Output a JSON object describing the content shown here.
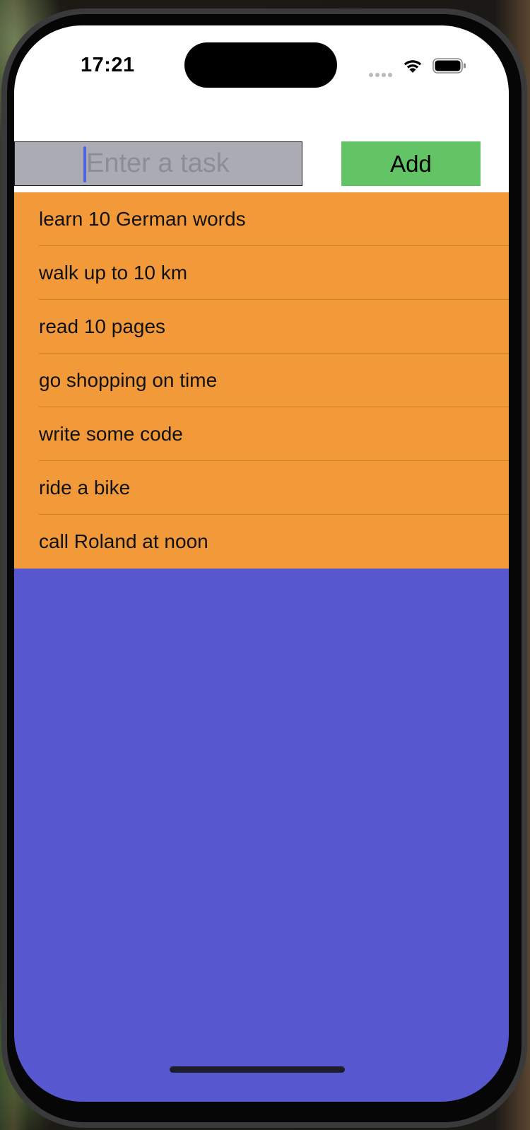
{
  "status_bar": {
    "time": "17:21",
    "icons": [
      "cellular-signal-icon",
      "wifi-icon",
      "battery-icon"
    ]
  },
  "input": {
    "placeholder": "Enter a task",
    "value": ""
  },
  "add_button": {
    "label": "Add"
  },
  "tasks": [
    "learn 10 German words",
    "walk up to 10 km",
    "read 10 pages",
    "go shopping on time",
    "write some code",
    "ride a bike",
    "call Roland at noon"
  ],
  "colors": {
    "list_background": "#f29a39",
    "page_background": "#5757cf",
    "add_button": "#63c466",
    "input_background": "#abacb3",
    "caret": "#4d66e0"
  }
}
